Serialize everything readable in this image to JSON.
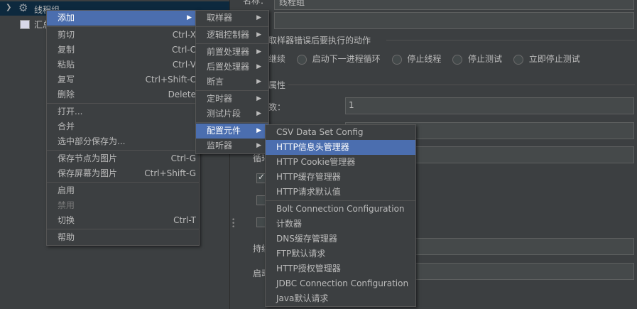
{
  "tree": {
    "thread_group": "线程组",
    "child": "汇总"
  },
  "right_panel": {
    "name_label": "名称：",
    "name_value": "线程组",
    "error_section": "取样器错误后要执行的动作",
    "error_actions": [
      "继续",
      "启动下一进程循环",
      "停止线程",
      "停止测试",
      "立即停止测试"
    ],
    "props_section": "属性",
    "threads_label": "数：",
    "threads_value": "1",
    "loop_label": "循环",
    "duration_label": "持续",
    "startup_label": "启动"
  },
  "context_menu": {
    "items": [
      {
        "label": "添加",
        "shortcut": "",
        "submenu": true,
        "selected": true
      },
      {
        "sep": true
      },
      {
        "label": "剪切",
        "shortcut": "Ctrl-X"
      },
      {
        "label": "复制",
        "shortcut": "Ctrl-C"
      },
      {
        "label": "粘贴",
        "shortcut": "Ctrl-V"
      },
      {
        "label": "复写",
        "shortcut": "Ctrl+Shift-C"
      },
      {
        "label": "删除",
        "shortcut": "Delete"
      },
      {
        "sep": true
      },
      {
        "label": "打开..."
      },
      {
        "label": "合并"
      },
      {
        "label": "选中部分保存为..."
      },
      {
        "sep": true
      },
      {
        "label": "保存节点为图片",
        "shortcut": "Ctrl-G"
      },
      {
        "label": "保存屏幕为图片",
        "shortcut": "Ctrl+Shift-G"
      },
      {
        "sep": true
      },
      {
        "label": "启用"
      },
      {
        "label": "禁用",
        "disabled": true
      },
      {
        "label": "切换",
        "shortcut": "Ctrl-T"
      },
      {
        "sep": true
      },
      {
        "label": "帮助"
      }
    ]
  },
  "add_submenu": {
    "items": [
      {
        "label": "取样器",
        "submenu": true
      },
      {
        "sep": true
      },
      {
        "label": "逻辑控制器",
        "submenu": true
      },
      {
        "sep": true
      },
      {
        "label": "前置处理器",
        "submenu": true
      },
      {
        "label": "后置处理器",
        "submenu": true
      },
      {
        "label": "断言",
        "submenu": true
      },
      {
        "sep": true
      },
      {
        "label": "定时器",
        "submenu": true
      },
      {
        "label": "测试片段",
        "submenu": true
      },
      {
        "sep": true
      },
      {
        "label": "配置元件",
        "submenu": true,
        "selected": true
      },
      {
        "label": "监听器",
        "submenu": true
      }
    ]
  },
  "config_submenu": {
    "items": [
      {
        "label": "CSV Data Set Config"
      },
      {
        "label": "HTTP信息头管理器",
        "selected": true
      },
      {
        "label": "HTTP Cookie管理器"
      },
      {
        "label": "HTTP缓存管理器"
      },
      {
        "label": "HTTP请求默认值"
      },
      {
        "sep": true
      },
      {
        "label": "Bolt Connection Configuration"
      },
      {
        "label": "计数器"
      },
      {
        "label": "DNS缓存管理器"
      },
      {
        "label": "FTP默认请求"
      },
      {
        "label": "HTTP授权管理器"
      },
      {
        "label": "JDBC Connection Configuration"
      },
      {
        "label": "Java默认请求"
      }
    ]
  },
  "colors": {
    "background": "#3c3f41",
    "selection": "#4b6eaf",
    "text": "#bbbbbb"
  }
}
